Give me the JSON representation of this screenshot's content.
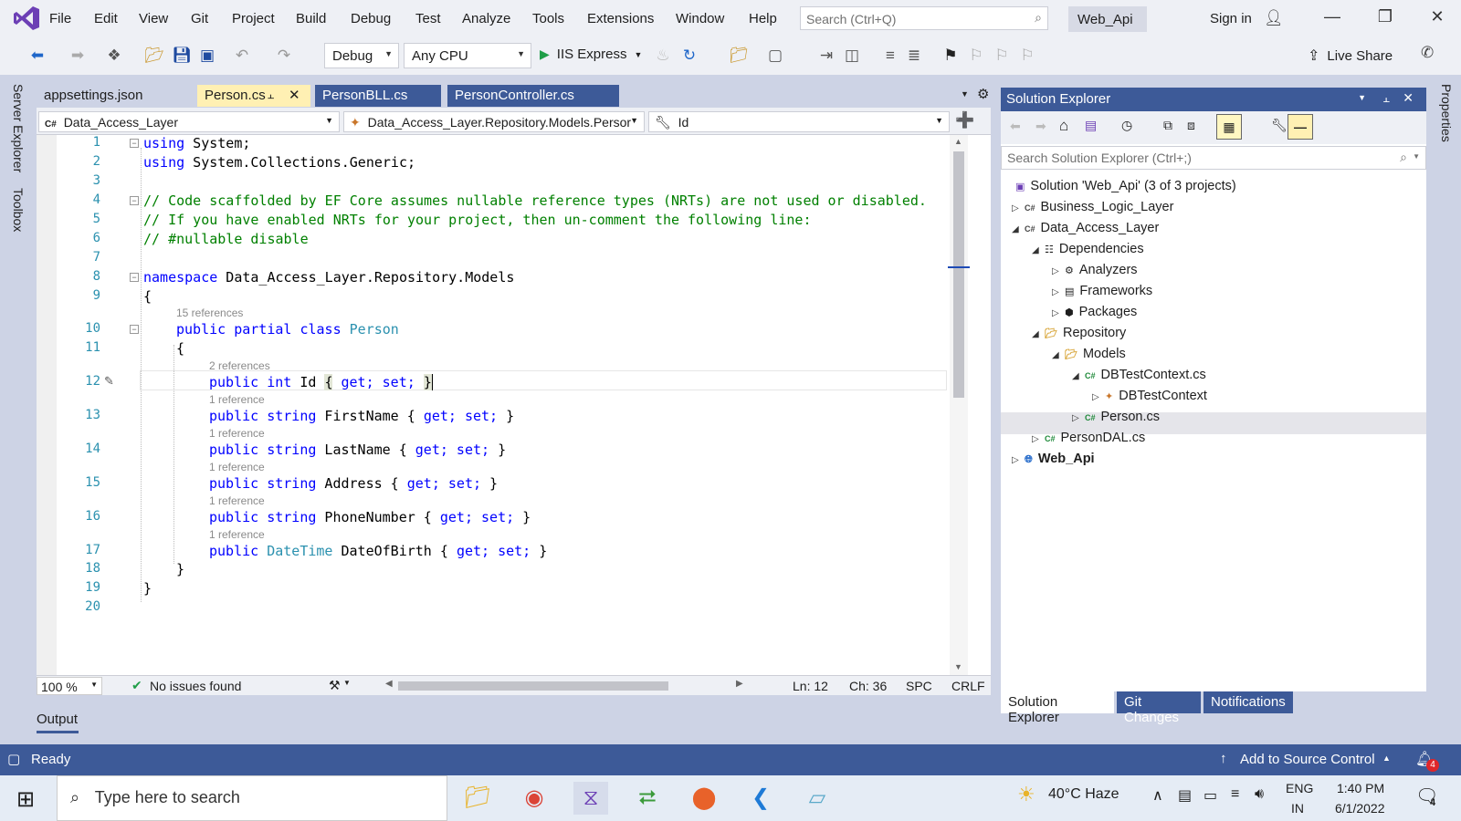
{
  "menu": [
    "File",
    "Edit",
    "View",
    "Git",
    "Project",
    "Build",
    "Debug",
    "Test",
    "Analyze",
    "Tools",
    "Extensions",
    "Window",
    "Help"
  ],
  "search": {
    "placeholder": "Search (Ctrl+Q)"
  },
  "solution_name": "Web_Api",
  "signin": "Sign in",
  "toolbar": {
    "config": "Debug",
    "platform": "Any CPU",
    "run": "IIS Express",
    "liveshare": "Live Share"
  },
  "left_dock": [
    "Server Explorer",
    "Toolbox"
  ],
  "right_dock": [
    "Properties"
  ],
  "tabs": [
    {
      "label": "appsettings.json"
    },
    {
      "label": "Person.cs"
    },
    {
      "label": "PersonBLL.cs"
    },
    {
      "label": "PersonController.cs"
    }
  ],
  "nav": {
    "project": "Data_Access_Layer",
    "type": "Data_Access_Layer.Repository.Models.Persor",
    "member": "Id"
  },
  "code": {
    "lines": [
      {
        "n": "1"
      },
      {
        "n": "2"
      },
      {
        "n": "3"
      },
      {
        "n": "4"
      },
      {
        "n": "5"
      },
      {
        "n": "6"
      },
      {
        "n": "7"
      },
      {
        "n": "8"
      },
      {
        "n": "9"
      },
      {
        "n": "10"
      },
      {
        "n": "11"
      },
      {
        "n": "12"
      },
      {
        "n": "13"
      },
      {
        "n": "14"
      },
      {
        "n": "15"
      },
      {
        "n": "16"
      },
      {
        "n": "17"
      },
      {
        "n": "18"
      },
      {
        "n": "19"
      },
      {
        "n": "20"
      }
    ],
    "l1": {
      "kw": "using",
      "rest": " System;"
    },
    "l2": {
      "kw": "using",
      "rest": " System.Collections.Generic;"
    },
    "l4": "// Code scaffolded by EF Core assumes nullable reference types (NRTs) are not used or disabled.",
    "l5": "// If you have enabled NRTs for your project, then un-comment the following line:",
    "l6": "// #nullable disable",
    "l8": {
      "kw": "namespace",
      "rest": " Data_Access_Layer.Repository.Models"
    },
    "l9": "{",
    "ref10": "15 references",
    "l10": {
      "kw": "public partial class",
      "ty": "Person"
    },
    "l11": "{",
    "ref12": "2 references",
    "l12": {
      "kw": "public int",
      "name": " Id ",
      "b1": "{",
      "kw2": " get; set; ",
      "b2": "}"
    },
    "ref13": "1 reference",
    "l13": {
      "kw": "public string",
      "name": " FirstName { ",
      "acc": "get; set;",
      "end": " }"
    },
    "ref14": "1 reference",
    "l14": {
      "kw": "public string",
      "name": " LastName { ",
      "acc": "get; set;",
      "end": " }"
    },
    "ref15": "1 reference",
    "l15": {
      "kw": "public string",
      "name": " Address { ",
      "acc": "get; set;",
      "end": " }"
    },
    "ref16": "1 reference",
    "l16": {
      "kw": "public string",
      "name": " PhoneNumber { ",
      "acc": "get; set;",
      "end": " }"
    },
    "ref17": "1 reference",
    "l17": {
      "kw": "public",
      "ty": " DateTime",
      "name": " DateOfBirth { ",
      "acc": "get; set;",
      "end": " }"
    },
    "l18": "}",
    "l19": "}"
  },
  "editor_status": {
    "zoom": "100 %",
    "issues": "No issues found",
    "ln": "Ln: 12",
    "ch": "Ch: 36",
    "spc": "SPC",
    "crlf": "CRLF"
  },
  "output_label": "Output",
  "solution_explorer": {
    "title": "Solution Explorer",
    "search_placeholder": "Search Solution Explorer (Ctrl+;)",
    "items": [
      {
        "label": "Solution 'Web_Api' (3 of 3 projects)"
      },
      {
        "label": "Business_Logic_Layer"
      },
      {
        "label": "Data_Access_Layer"
      },
      {
        "label": "Dependencies"
      },
      {
        "label": "Analyzers"
      },
      {
        "label": "Frameworks"
      },
      {
        "label": "Packages"
      },
      {
        "label": "Repository"
      },
      {
        "label": "Models"
      },
      {
        "label": "DBTestContext.cs"
      },
      {
        "label": "DBTestContext"
      },
      {
        "label": "Person.cs"
      },
      {
        "label": "PersonDAL.cs"
      },
      {
        "label": "Web_Api"
      }
    ],
    "tabs": [
      "Solution Explorer",
      "Git Changes",
      "Notifications"
    ]
  },
  "statusbar": {
    "ready": "Ready",
    "source_control": "Add to Source Control",
    "notif_count": "4"
  },
  "taskbar": {
    "search_placeholder": "Type here to search",
    "weather": "40°C  Haze",
    "lang": "ENG",
    "region": "IN",
    "time": "1:40 PM",
    "date": "6/1/2022",
    "notif": "4"
  },
  "colors": {
    "accent": "#3d5a98",
    "active_tab": "#fff0b3",
    "keyword": "#0000ff",
    "type": "#2b91af",
    "comment": "#008000"
  }
}
